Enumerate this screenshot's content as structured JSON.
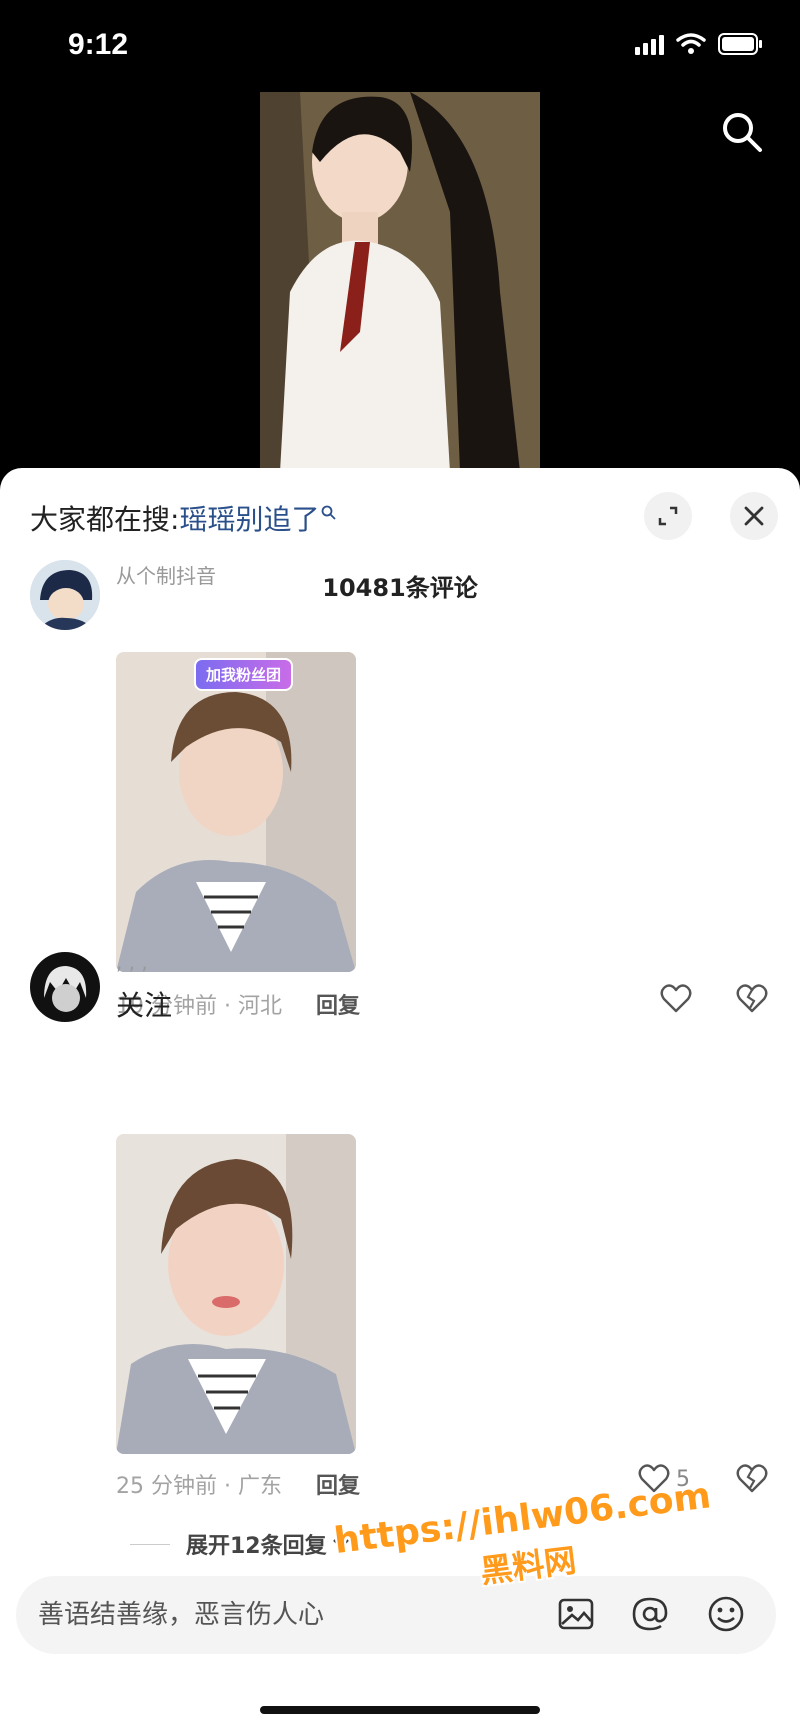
{
  "status": {
    "time": "9:12"
  },
  "trending": {
    "prefix": "大家都在搜:",
    "keyword": "瑶瑶别追了"
  },
  "comments_header": {
    "count_label": "10481条评论"
  },
  "comments": [
    {
      "username": "从个制抖音",
      "text": "",
      "time_location": "19 分钟前 · 河北",
      "reply_label": "回复",
      "likes": "",
      "sticker_label": "加我粉丝团"
    },
    {
      "username": ", , ,",
      "text": "关注",
      "time_location": "25 分钟前 · 广东",
      "reply_label": "回复",
      "likes": "5"
    }
  ],
  "expand_replies": {
    "label": "展开12条回复"
  },
  "input": {
    "placeholder": "善语结善缘，恶言伤人心"
  },
  "watermark": {
    "url": "https://ihlw06.com",
    "name": "黑料网"
  },
  "icons": {
    "search": "search-icon",
    "expand": "expand-icon",
    "close": "close-icon",
    "like": "heart-icon",
    "dislike": "broken-heart-icon",
    "image": "image-icon",
    "mention": "at-icon",
    "emoji": "emoji-icon"
  },
  "colors": {
    "keyword": "#2a4f8a",
    "watermark": "#ff9a1a"
  }
}
